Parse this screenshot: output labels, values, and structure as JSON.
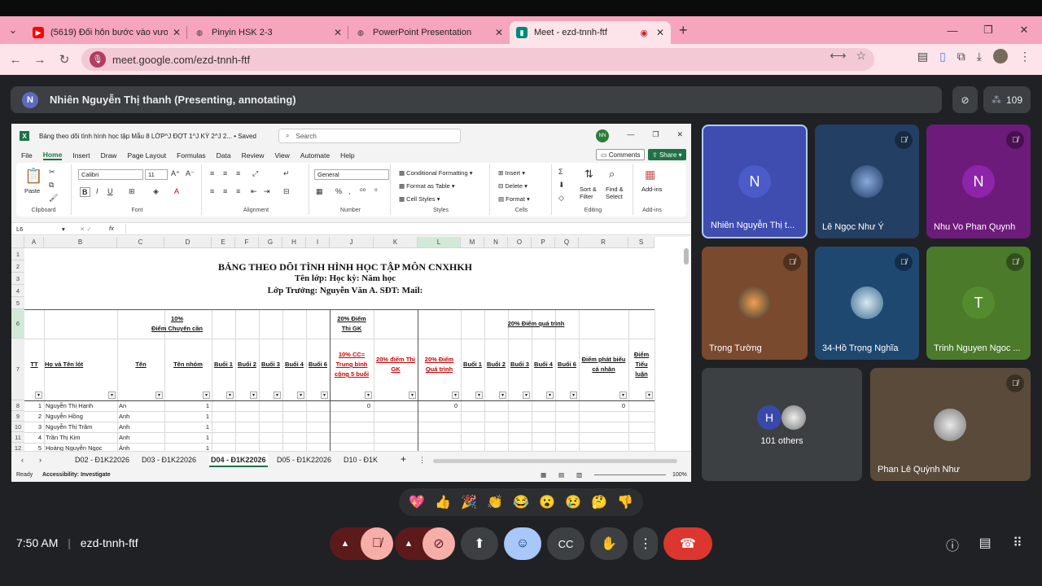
{
  "browser": {
    "tabs": [
      {
        "title": "(5619) Đối hôn bước vào vương"
      },
      {
        "title": "Pinyin HSK 2-3"
      },
      {
        "title": "PowerPoint Presentation"
      },
      {
        "title": "Meet - ezd-tnnh-ftf"
      }
    ],
    "url": "meet.google.com/ezd-tnnh-ftf"
  },
  "meet": {
    "presenter_initial": "N",
    "presenter_banner": "Nhiên Nguyễn Thị thanh (Presenting, annotating)",
    "participant_count": "109",
    "time": "7:50 AM",
    "meeting_code": "ezd-tnnh-ftf",
    "participants": [
      {
        "name": "Nhiên Nguyễn Thị t...",
        "initial": "N",
        "color": "#3949ab"
      },
      {
        "name": "Lê Ngọc Như Ý"
      },
      {
        "name": "Nhu Vo Phan Quynh",
        "initial": "N",
        "color": "#8e24aa"
      },
      {
        "name": "Trọng Tường"
      },
      {
        "name": "34-Hồ Trọng Nghĩa"
      },
      {
        "name": "Trinh Nguyen Ngoc ...",
        "initial": "T",
        "color": "#558b2f"
      },
      {
        "name": "101 others",
        "initial": "H"
      },
      {
        "name": "Phan Lê Quỳnh Như"
      }
    ],
    "reactions": [
      "💖",
      "👍",
      "🎉",
      "👏",
      "😂",
      "😮",
      "😢",
      "🤔",
      "👎"
    ]
  },
  "excel": {
    "title": "Bảng theo dõi tình hình học tập Mẫu 8 LỚP^J ĐỢT 1^J KỲ 2^J 2... • Saved",
    "search_placeholder": "Search",
    "user_initials": "NN",
    "menu": [
      "File",
      "Home",
      "Insert",
      "Draw",
      "Page Layout",
      "Formulas",
      "Data",
      "Review",
      "View",
      "Automate",
      "Help"
    ],
    "comments": "Comments",
    "share": "Share",
    "font": "Calibri",
    "font_size": "11",
    "number_format": "General",
    "ribbon_labels": {
      "paste": "Paste",
      "clipboard": "Clipboard",
      "font": "Font",
      "alignment": "Alignment",
      "number": "Number",
      "cond_format": "Conditional Formatting",
      "format_table": "Format as Table",
      "cell_styles": "Cell Styles",
      "styles": "Styles",
      "insert": "Insert",
      "delete": "Delete",
      "format": "Format",
      "cells": "Cells",
      "sort_filter": "Sort & Filter",
      "find_select": "Find & Select",
      "editing": "Editing",
      "addins": "Add-ins"
    },
    "name_box": "L6",
    "fx": "fx",
    "columns": [
      "A",
      "B",
      "C",
      "D",
      "E",
      "F",
      "G",
      "H",
      "I",
      "J",
      "K",
      "L",
      "M",
      "N",
      "O",
      "P",
      "Q",
      "R",
      "S"
    ],
    "rows": [
      "1",
      "2",
      "3",
      "4",
      "5",
      "6",
      "7",
      "8",
      "9",
      "10",
      "11",
      "12"
    ],
    "title_lines": [
      "BẢNG THEO DÕI TÌNH HÌNH HỌC TẬP MÔN CNXHKH",
      "Tên lớp:  Học kỳ:  Năm học",
      "Lớp Trưởng: Nguyễn Văn A. SĐT:    Mail:"
    ],
    "headers": {
      "attendance": "10%\nĐiểm Chuyên cần",
      "midterm": "20% Điểm\nThi GK",
      "process": "20% Điểm quá trình",
      "tt": "TT",
      "hoten": "Họ và Tên lót",
      "ten": "Tên",
      "tennhom": "Tên nhóm",
      "b1": "Buổi 1",
      "b2": "Buổi 2",
      "b3": "Buổi 3",
      "b4": "Buổi 4",
      "b6": "Buổi 6",
      "cc": "10% CC= Trung bình cộng 5 buổi",
      "gk": "20% điểm Thi GK",
      "qt": "20% Điểm Quá trình",
      "pb": "Điểm phát biểu cá nhân",
      "tl": "Điểm Tiểu luận"
    },
    "students": [
      {
        "tt": "1",
        "ho": "Nguyễn Thị Hạnh",
        "ten": "An",
        "nhom": "1",
        "cc": "0",
        "qt": "0",
        "pb": "0"
      },
      {
        "tt": "2",
        "ho": "Nguyễn Hồng",
        "ten": "Anh",
        "nhom": "1"
      },
      {
        "tt": "3",
        "ho": "Nguyễn Thị Trâm",
        "ten": "Anh",
        "nhom": "1"
      },
      {
        "tt": "4",
        "ho": "Trần Thị Kim",
        "ten": "Anh",
        "nhom": "1"
      },
      {
        "tt": "5",
        "ho": "Hoàng Nguyễn Ngọc",
        "ten": "Ánh",
        "nhom": "1"
      }
    ],
    "sheets": [
      "D02 - Đ1K22026",
      "D03 - Đ1K22026",
      "D04 - Đ1K22026",
      "D05 - Đ1K22026",
      "D10 - Đ1K"
    ],
    "status_ready": "Ready",
    "status_access": "Accessibility: Investigate",
    "zoom": "100%"
  }
}
